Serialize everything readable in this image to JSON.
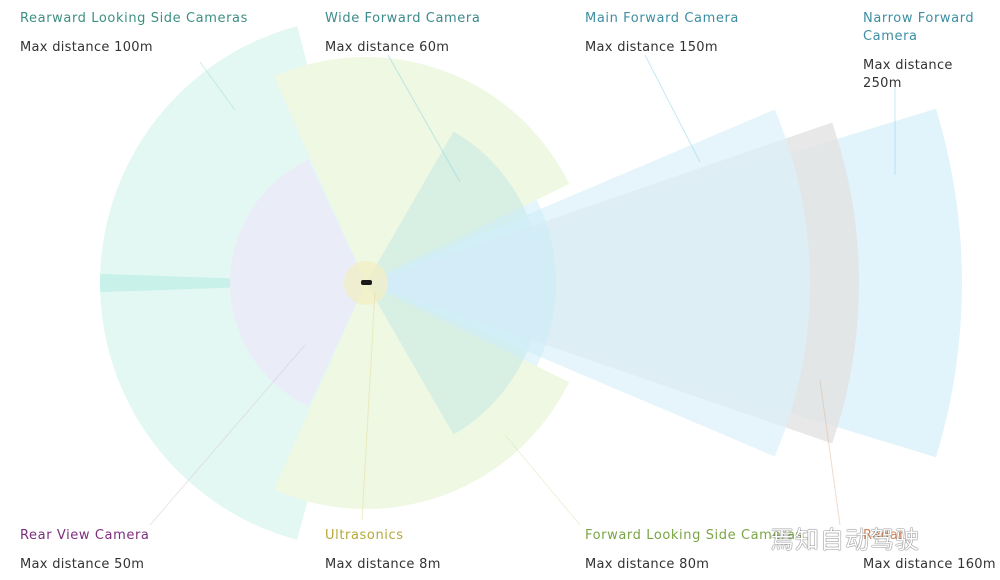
{
  "sensors": [
    {
      "key": "rearward",
      "label": "Rearward Looking Side Cameras",
      "distance": "Max distance 100m",
      "color": "#3c8f82",
      "fill": "#e4f8f3"
    },
    {
      "key": "wide",
      "label": "Wide Forward Camera",
      "distance": "Max distance 60m",
      "color": "#3c8a8a",
      "fill": "#d4efe3"
    },
    {
      "key": "main",
      "label": "Main Forward Camera",
      "distance": "Max distance 150m",
      "color": "#3d8ea3",
      "fill": "#dcf1fa"
    },
    {
      "key": "narrow",
      "label": "Narrow Forward Camera",
      "distance": "Max distance 250m",
      "color": "#3d8ea3",
      "fill": "#dcf1fa"
    },
    {
      "key": "rearview",
      "label": "Rear View Camera",
      "distance": "Max distance 50m",
      "color": "#7b2d7b",
      "fill": "#eaecf7"
    },
    {
      "key": "ultrasonics",
      "label": "Ultrasonics",
      "distance": "Max distance 8m",
      "color": "#b5a83a",
      "fill": "#f1efc6"
    },
    {
      "key": "sidefwd",
      "label": "Forward Looking Side Cameras",
      "distance": "Max distance 80m",
      "color": "#7ba545",
      "fill": "#eef8e1"
    },
    {
      "key": "radar",
      "label": "Radar",
      "distance": "Max distance 160m",
      "color": "#d4865a",
      "fill": "#e2e2e2"
    }
  ],
  "watermark": "焉知自动驾驶"
}
